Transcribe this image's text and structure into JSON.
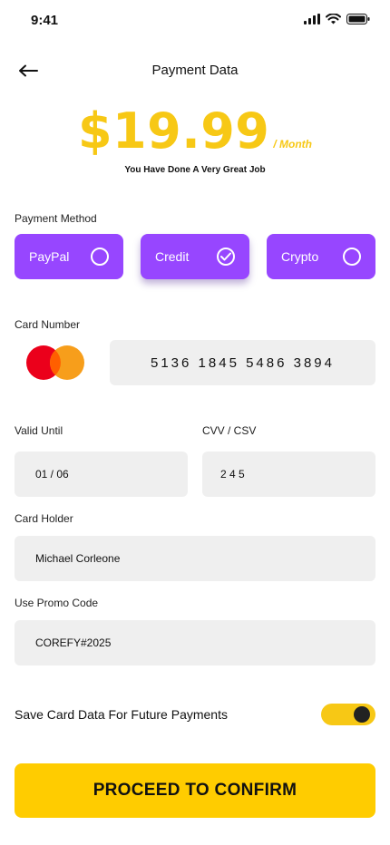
{
  "status_bar": {
    "time": "9:41",
    "icons": [
      "signal-icon",
      "wifi-icon",
      "battery-icon"
    ]
  },
  "header": {
    "title": "Payment Data",
    "back_icon": "arrow-left-icon"
  },
  "pricing": {
    "price": "$19.99",
    "period": "/ Month",
    "tagline": "You Have Done A Very Great Job"
  },
  "payment_method": {
    "label": "Payment Method",
    "options": [
      {
        "label": "PayPal",
        "selected": false
      },
      {
        "label": "Credit",
        "selected": true
      },
      {
        "label": "Crypto",
        "selected": false
      }
    ]
  },
  "card_number": {
    "label": "Card Number",
    "value": "5136  1845  5486  3894",
    "brand_icon": "mastercard-icon"
  },
  "valid_until": {
    "label": "Valid Until",
    "value": "01 / 06"
  },
  "cvv": {
    "label": "CVV / CSV",
    "value": "2 4 5"
  },
  "card_holder": {
    "label": "Card Holder",
    "value": "Michael Corleone"
  },
  "promo_code": {
    "label": "Use Promo Code",
    "value": "COREFY#2025"
  },
  "save_card": {
    "label": "Save Card Data For Future Payments",
    "enabled": true
  },
  "cta": {
    "label": "PROCEED TO CONFIRM"
  },
  "colors": {
    "accent_purple": "#9746ff",
    "accent_yellow": "#f7c815",
    "button_yellow": "#ffcc00",
    "field_bg": "#efefef"
  }
}
